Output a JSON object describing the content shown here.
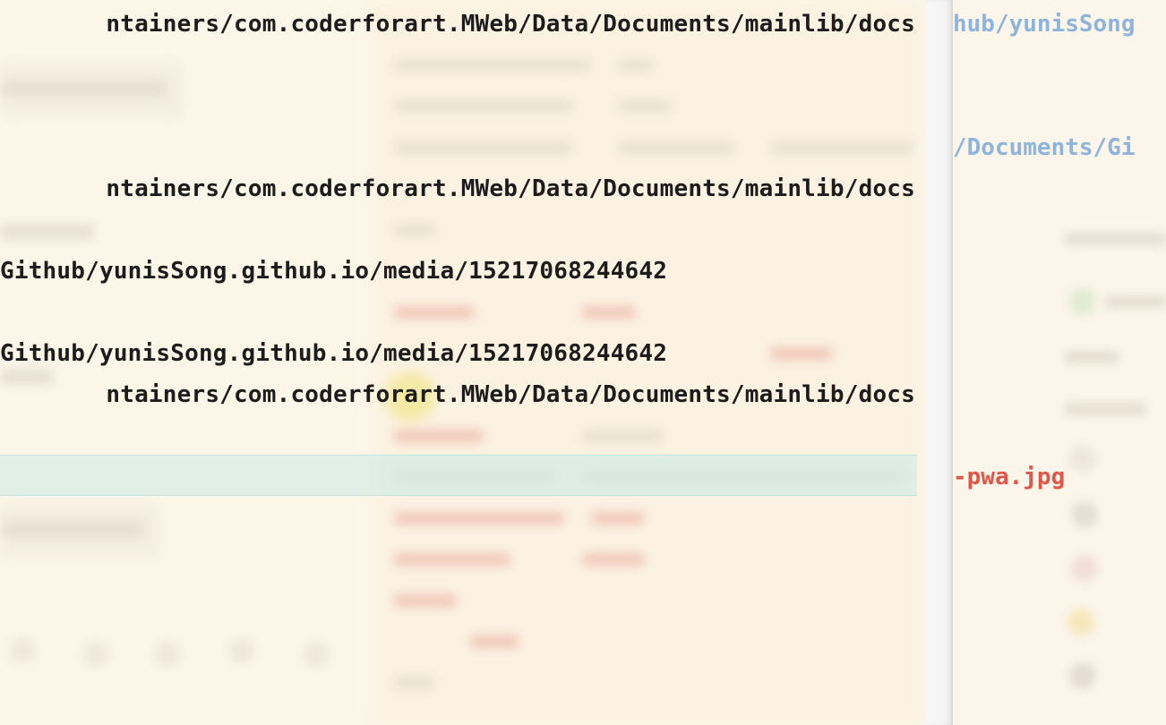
{
  "terminal": {
    "lines": [
      "ntainers/com.coderforart.MWeb/Data/Documents/mainlib/docs",
      "ntainers/com.coderforart.MWeb/Data/Documents/mainlib/docs",
      "Github/yunisSong.github.io/media/15217068244642",
      "Github/yunisSong.github.io/media/15217068244642",
      "ntainers/com.coderforart.MWeb/Data/Documents/mainlib/docs"
    ]
  },
  "right_pane": {
    "lines": [
      "hub/yunisSong",
      "/Documents/Gi",
      "-pwa.jpg"
    ]
  },
  "colors": {
    "terminal_text": "#1c1c1c",
    "link_blue": "#8fb4dc",
    "file_red": "#e0574a",
    "background": "#fbf4e8",
    "highlight": "#c8ebe8"
  }
}
